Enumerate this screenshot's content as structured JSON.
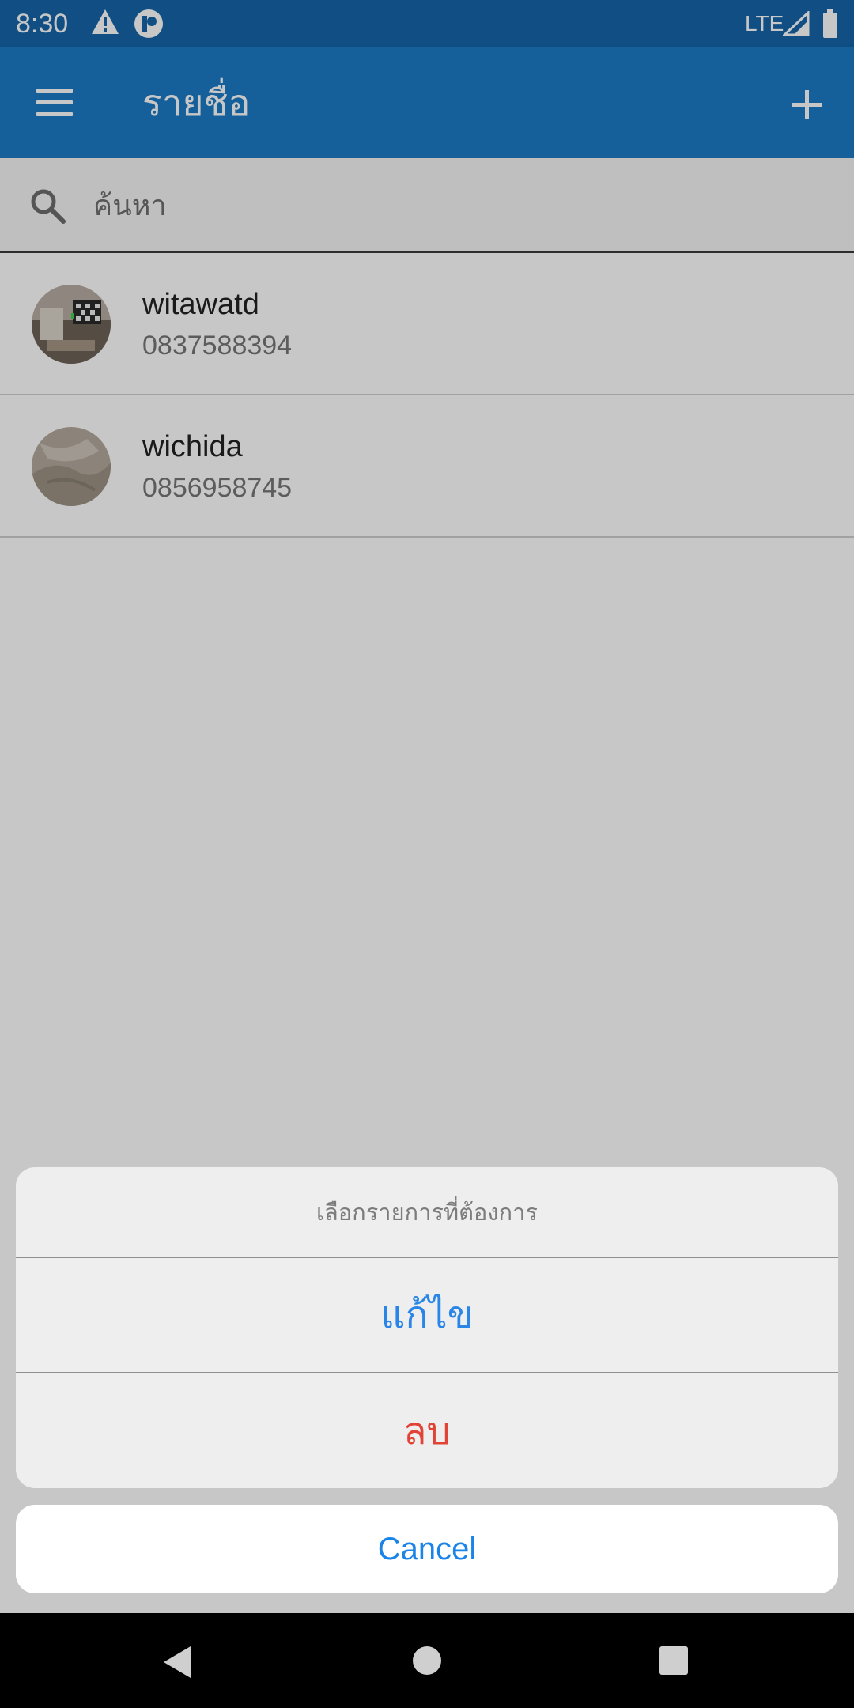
{
  "status_bar": {
    "time": "8:30",
    "network": "LTE",
    "icons": [
      "warning-icon",
      "app-notification-icon",
      "signal-icon",
      "battery-icon"
    ]
  },
  "app_bar": {
    "title": "รายชื่อ",
    "icons": [
      "menu-icon",
      "plus-icon"
    ]
  },
  "search": {
    "placeholder": "ค้นหา",
    "value": ""
  },
  "contacts": [
    {
      "name": "witawatd",
      "phone": "0837588394"
    },
    {
      "name": "wichida",
      "phone": "0856958745"
    }
  ],
  "action_sheet": {
    "title": "เลือกรายการที่ต้องการ",
    "edit_label": "แก้ไข",
    "delete_label": "ลบ",
    "cancel_label": "Cancel"
  },
  "colors": {
    "status_bar": "#1565a8",
    "app_bar": "#1b7bc6",
    "edit_action": "#2a86e6",
    "delete_action": "#e14437",
    "cancel_action": "#1a84e8"
  }
}
